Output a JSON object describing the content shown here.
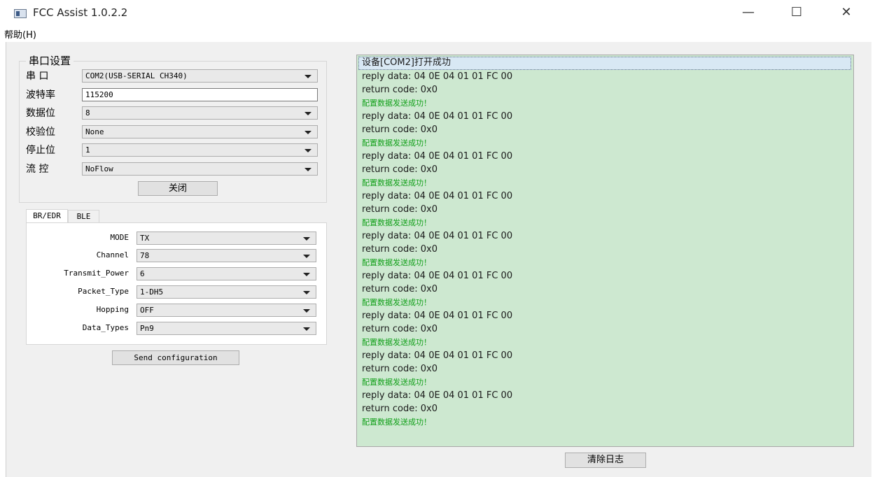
{
  "window": {
    "title": "FCC Assist 1.0.2.2",
    "controls": {
      "minimize": "—",
      "maximize": "☐",
      "close": "✕"
    }
  },
  "menu": {
    "help": "帮助(H)"
  },
  "serial": {
    "group_title": "串口设置",
    "port_label": "串  口",
    "port_value": "COM2(USB-SERIAL CH340)",
    "baud_label": "波特率",
    "baud_value": "115200",
    "databits_label": "数据位",
    "databits_value": "8",
    "parity_label": "校验位",
    "parity_value": "None",
    "stopbits_label": "停止位",
    "stopbits_value": "1",
    "flow_label": "流  控",
    "flow_value": "NoFlow",
    "close_button": "关闭"
  },
  "tabs": [
    {
      "label": "BR/EDR",
      "active": true
    },
    {
      "label": "BLE",
      "active": false
    }
  ],
  "params": [
    {
      "label": "MODE",
      "value": "TX"
    },
    {
      "label": "Channel",
      "value": "78"
    },
    {
      "label": "Transmit_Power",
      "value": "6"
    },
    {
      "label": "Packet_Type",
      "value": "1-DH5"
    },
    {
      "label": "Hopping",
      "value": "OFF"
    },
    {
      "label": "Data_Types",
      "value": "Pn9"
    }
  ],
  "send_button": "Send configuration",
  "log": {
    "first_line": "设备[COM2]打开成功",
    "lines": [
      "reply data: 04 0E 04 01 01 FC 00",
      "return code: 0x0",
      "配置数据发送成功！",
      "reply data: 04 0E 04 01 01 FC 00",
      "return code: 0x0",
      "配置数据发送成功！",
      "reply data: 04 0E 04 01 01 FC 00",
      "return code: 0x0",
      "配置数据发送成功！",
      "reply data: 04 0E 04 01 01 FC 00",
      "return code: 0x0",
      "配置数据发送成功！",
      "reply data: 04 0E 04 01 01 FC 00",
      "return code: 0x0",
      "配置数据发送成功！",
      "reply data: 04 0E 04 01 01 FC 00",
      "return code: 0x0",
      "配置数据发送成功！",
      "reply data: 04 0E 04 01 01 FC 00",
      "return code: 0x0",
      "配置数据发送成功！",
      "reply data: 04 0E 04 01 01 FC 00",
      "return code: 0x0",
      "配置数据发送成功！",
      "reply data: 04 0E 04 01 01 FC 00",
      "return code: 0x0",
      "配置数据发送成功！"
    ],
    "success_color": "#12a01a",
    "background_color": "#cde8d0"
  },
  "clear_log_button": "清除日志"
}
